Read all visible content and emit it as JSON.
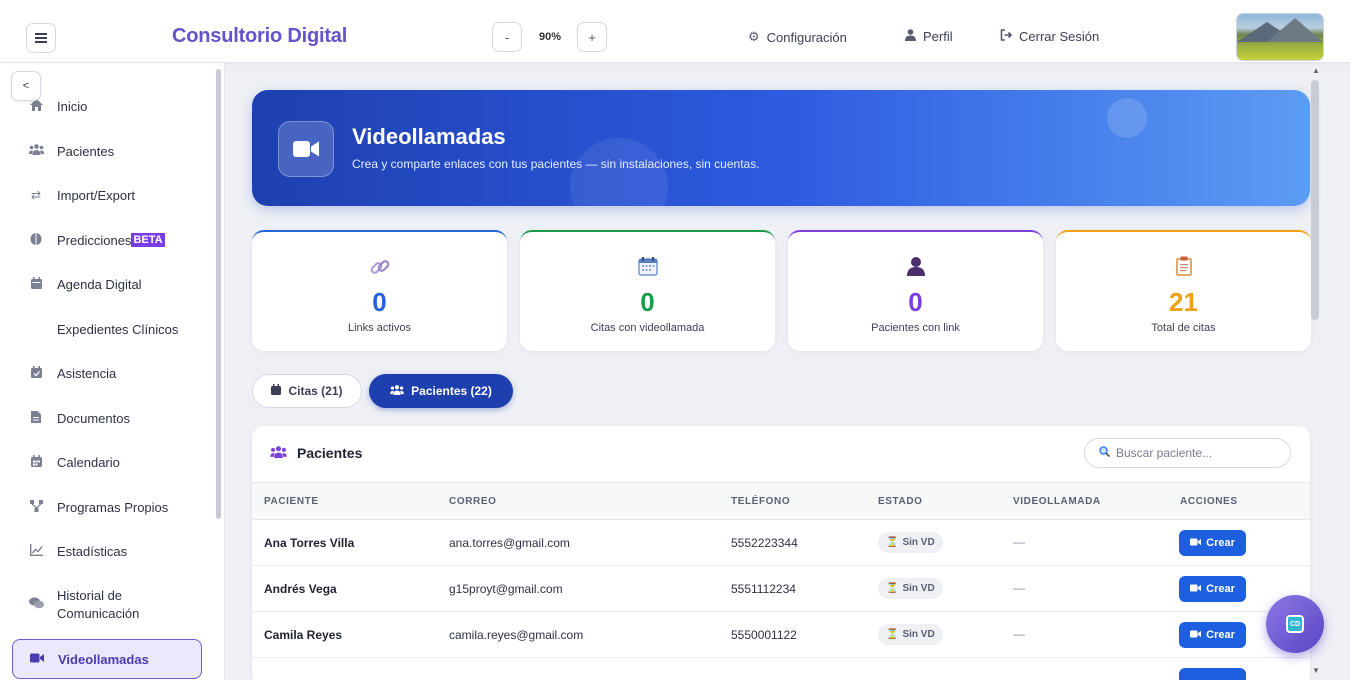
{
  "header": {
    "brand": "Consultorio Digital",
    "zoom_minus": "-",
    "zoom_value": "90%",
    "zoom_plus": "+",
    "settings": "Configuración",
    "profile": "Perfil",
    "logout": "Cerrar Sesión"
  },
  "sidebar": {
    "collapse": "<",
    "items": [
      {
        "label": "Inicio",
        "icon": "home-icon"
      },
      {
        "label": "Pacientes",
        "icon": "users-icon"
      },
      {
        "label": "Import/Export",
        "icon": "exchange-icon"
      },
      {
        "label": "Predicciones",
        "icon": "brain-icon",
        "badge": "BETA"
      },
      {
        "label": "Agenda Digital",
        "icon": "calendar-icon"
      },
      {
        "label": "Expedientes Clínicos",
        "icon": ""
      },
      {
        "label": "Asistencia",
        "icon": "calendar-check-icon"
      },
      {
        "label": "Documentos",
        "icon": "file-icon"
      },
      {
        "label": "Calendario",
        "icon": "calendar-grid-icon"
      },
      {
        "label": "Programas Propios",
        "icon": "network-icon"
      },
      {
        "label": "Estadísticas",
        "icon": "chart-line-icon"
      },
      {
        "label": "Historial de Comunicación",
        "icon": "comments-icon"
      },
      {
        "label": "Videollamadas",
        "icon": "video-icon",
        "active": true
      }
    ]
  },
  "hero": {
    "title": "Videollamadas",
    "subtitle": "Crea y comparte enlaces con tus pacientes — sin instalaciones, sin cuentas."
  },
  "stats": [
    {
      "value": "0",
      "label": "Links activos",
      "color": "#2463d8",
      "icon": "link-icon"
    },
    {
      "value": "0",
      "label": "Citas con videollamada",
      "color": "#1a9b4a",
      "icon": "calendar-icon"
    },
    {
      "value": "0",
      "label": "Pacientes con link",
      "color": "#7b3fe0",
      "icon": "user-icon"
    },
    {
      "value": "21",
      "label": "Total de citas",
      "color": "#f0a014",
      "icon": "clipboard-icon"
    }
  ],
  "tabs": {
    "citas": "Citas (21)",
    "pacientes": "Pacientes (22)"
  },
  "panel": {
    "title": "Pacientes",
    "search_placeholder": "Buscar paciente..."
  },
  "table": {
    "columns": [
      "PACIENTE",
      "CORREO",
      "TELÉFONO",
      "ESTADO",
      "VIDEOLLAMADA",
      "ACCIONES"
    ],
    "rows": [
      {
        "name": "Ana Torres Villa",
        "email": "ana.torres@gmail.com",
        "phone": "5552223344",
        "status": "Sin VD",
        "video": "—",
        "action": "Crear"
      },
      {
        "name": "Andrés Vega",
        "email": "g15proyt@gmail.com",
        "phone": "5551112234",
        "status": "Sin VD",
        "video": "—",
        "action": "Crear"
      },
      {
        "name": "Camila Reyes",
        "email": "camila.reyes@gmail.com",
        "phone": "5550001122",
        "status": "Sin VD",
        "video": "—",
        "action": "Crear"
      }
    ]
  },
  "fab": {
    "label": "CD"
  }
}
